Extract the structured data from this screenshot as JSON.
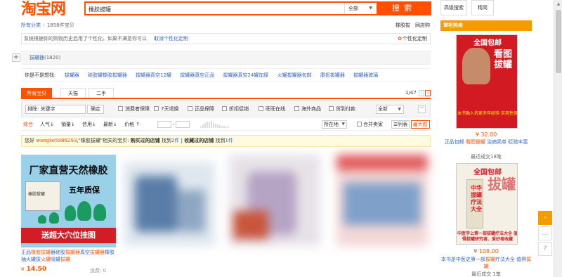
{
  "header": {
    "logo": "淘宝网",
    "search_value": "橡胶拔罐",
    "search_category": "全部",
    "search_button": "搜索",
    "advanced_search": "高级搜索",
    "precise": "精简"
  },
  "breadcrumb": {
    "root": "所有分类",
    "count": "1858件宝贝",
    "right_links": [
      "橡胶拔",
      "网店购"
    ]
  },
  "notice": {
    "text": "系统根据你的购物历史启用了个性化，如果不满意你可以",
    "cancel_link": "取消个性化定制",
    "settings": "个性化定制"
  },
  "category": {
    "name": "拔罐器",
    "count": "(1820)"
  },
  "wanted": {
    "label": "你是不是想找:",
    "suggestions": [
      "拔罐器",
      "硅胶罐橡胶拔罐器",
      "拔罐器真空12罐",
      "拔罐器真空正品",
      "拔罐器真空24罐加厚",
      "火罐拔罐器包邮",
      "康祝拔罐器",
      "拔罐器玻璃"
    ]
  },
  "tabs": {
    "items": [
      "所有宝贝",
      "天猫",
      "二手"
    ],
    "page": "1/47"
  },
  "filter": {
    "exclude_label": "排除:",
    "exclude_value": "关键字",
    "confirm": "确定",
    "checks": [
      "消费者保障",
      "7天退换",
      "正品保障",
      "折扣促销",
      "旺旺在线",
      "海外商品",
      "货到付款"
    ],
    "select_all": "全新"
  },
  "sort": {
    "items": [
      "综合",
      "人气",
      "销量",
      "信用",
      "最新",
      "价格"
    ],
    "location": "所在地",
    "merge_sellers": "合并卖家",
    "view_list": "列表",
    "view_grid": "大图"
  },
  "tip": {
    "prefix": "您好",
    "user": "wangke5889293",
    "mid1": ",\"橡胶拔罐\"相关的宝贝:",
    "bought_label": "购买过的店铺",
    "found1": "找到",
    "count1": "2件",
    "bar": "|",
    "fav_label": "收藏过的店铺",
    "found2": "找到",
    "count2": "1件"
  },
  "product": {
    "banner_top": "厂家直营天然橡胶",
    "banner_mid": "五年质保",
    "box_text": "橡胶拔罐",
    "banner_bottom": "送超大穴位挂图",
    "title_parts": [
      "正品",
      "橡胶拔罐",
      "器硅胶",
      "拔罐器",
      "真空",
      "拔罐器",
      "橡胶抽火罐拔",
      "火罐",
      "吸罐",
      "拔罐"
    ],
    "price_currency": "¥",
    "price": "14.50",
    "freight": "运费: 0"
  },
  "sidebar": {
    "header": "掌柜热卖",
    "item1": {
      "cover_top": "全国包邮",
      "cover_big": "看图拔罐",
      "cover_bottom": "本书融入名家多年经验 实用性强",
      "price": "¥ 32.00",
      "title_parts": [
        "正品包邮",
        " 看图",
        "拔罐",
        " 治病简单 砭疏丰富"
      ],
      "sold": "最近成交18笔"
    },
    "item2": {
      "cover_top": "全国包邮",
      "cover_big": "拔罐",
      "cover_sub": "中华拔罐疗法大全",
      "cover_bottom": "中医学上第一部拔罐疗法大全 值得拔罐研究者、爱好者收藏",
      "price": "¥ 108.00",
      "title_parts": [
        "本书是中医史第一部",
        "拔罐",
        "疗法大全 值得",
        "拔罐"
      ],
      "sold": "最近成交 1笔"
    }
  },
  "widgets": {
    "arrow": "›",
    "feedback": "…",
    "help": "?"
  },
  "colors": {
    "brand": "#ff5000",
    "sidebar_header": "#f59b00",
    "link": "#3366cc"
  }
}
